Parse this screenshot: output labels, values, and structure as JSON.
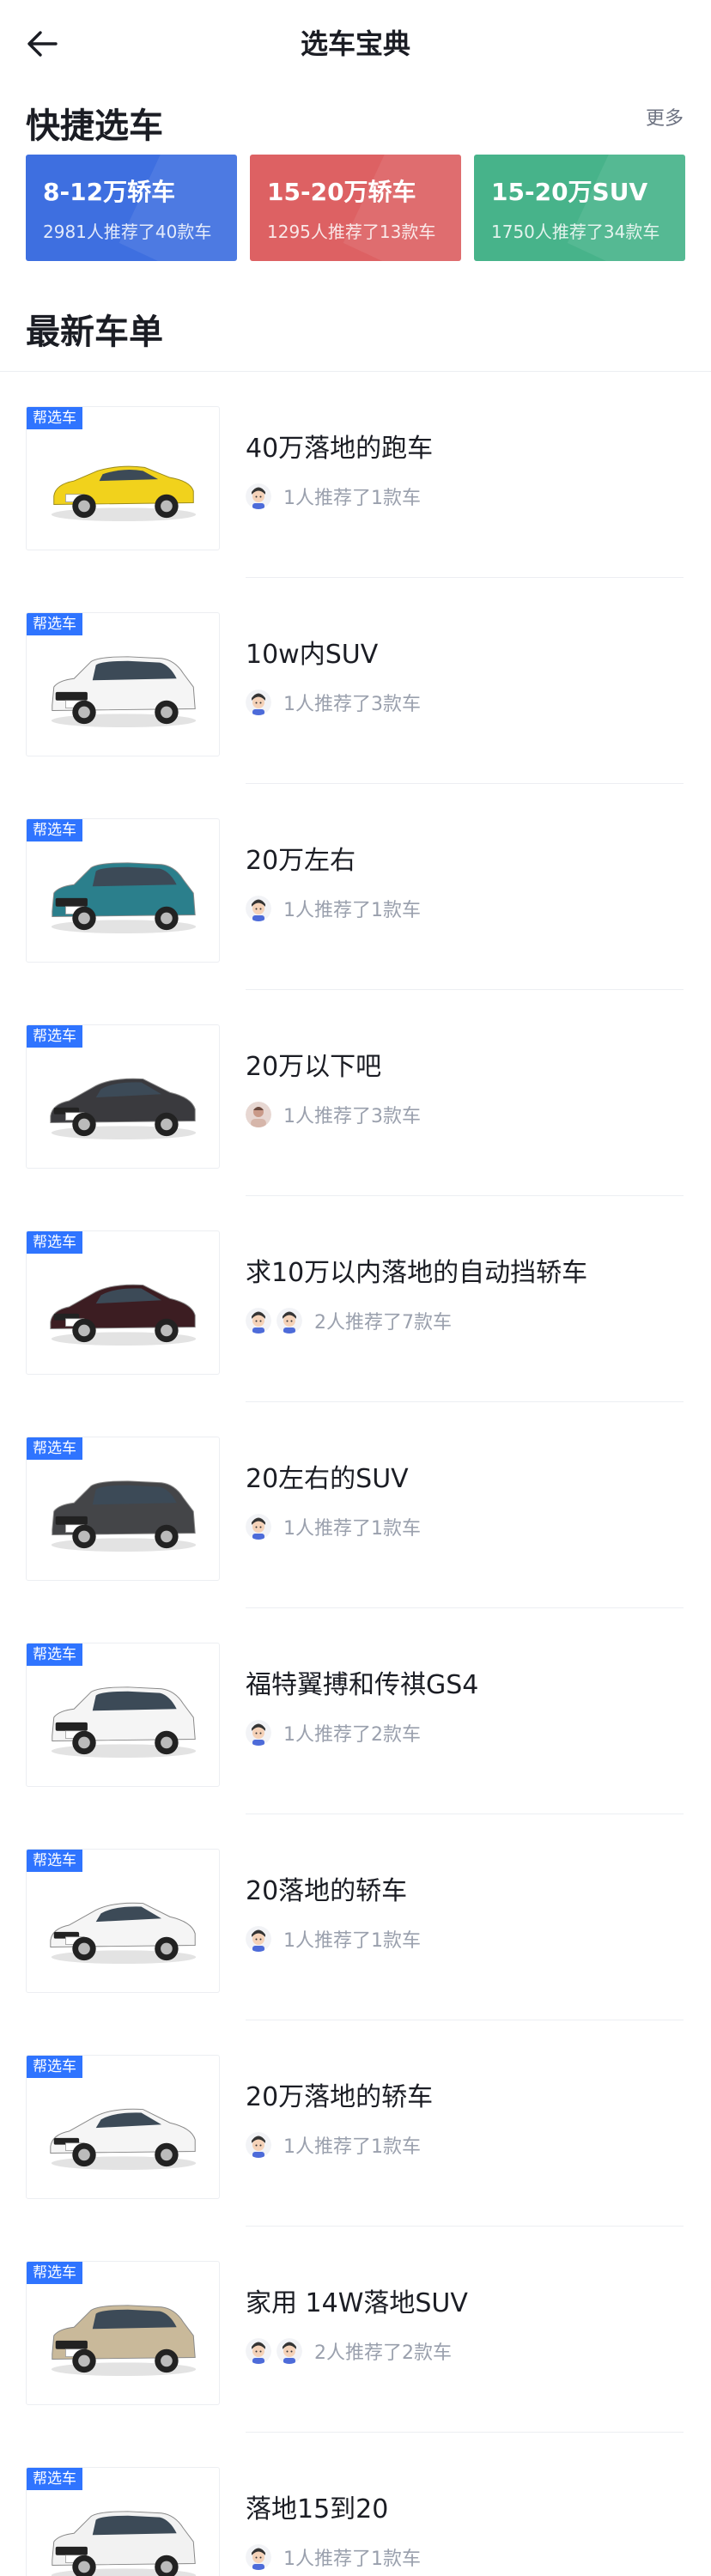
{
  "header": {
    "title": "选车宝典"
  },
  "quick": {
    "title": "快捷选车",
    "more": "更多",
    "cards": [
      {
        "title": "8-12万轿车",
        "sub": "2981人推荐了40款车",
        "color": "#3e6fe0"
      },
      {
        "title": "15-20万轿车",
        "sub": "1295人推荐了13款车",
        "color": "#dd6163"
      },
      {
        "title": "15-20万SUV",
        "sub": "1750人推荐了34款车",
        "color": "#47b38a"
      }
    ]
  },
  "latest": {
    "title": "最新车单",
    "tag": "帮选车",
    "items": [
      {
        "title": "40万落地的跑车",
        "meta": "1人推荐了1款车",
        "car": "sports",
        "color": "#f1d21c"
      },
      {
        "title": "10w内SUV",
        "meta": "1人推荐了3款车",
        "car": "suv",
        "color": "#f5f5f5"
      },
      {
        "title": "20万左右",
        "meta": "1人推荐了1款车",
        "car": "suv",
        "color": "#2b7f8c"
      },
      {
        "title": "20万以下吧",
        "meta": "1人推荐了3款车",
        "car": "sedan",
        "color": "#3a3a3e"
      },
      {
        "title": "求10万以内落地的自动挡轿车",
        "meta": "2人推荐了7款车",
        "car": "sedan",
        "color": "#3c1d22"
      },
      {
        "title": "20左右的SUV",
        "meta": "1人推荐了1款车",
        "car": "suv",
        "color": "#444548"
      },
      {
        "title": "福特翼搏和传祺GS4",
        "meta": "1人推荐了2款车",
        "car": "suv",
        "color": "#f5f5f5"
      },
      {
        "title": "20落地的轿车",
        "meta": "1人推荐了1款车",
        "car": "sedan",
        "color": "#f5f5f5"
      },
      {
        "title": "20万落地的轿车",
        "meta": "1人推荐了1款车",
        "car": "sedan",
        "color": "#f5f5f5"
      },
      {
        "title": "家用 14W落地SUV",
        "meta": "2人推荐了2款车",
        "car": "suv",
        "color": "#c9b99a"
      },
      {
        "title": "落地15到20",
        "meta": "1人推荐了1款车",
        "car": "suv",
        "color": "#f2f2f2"
      }
    ]
  },
  "colors": {
    "tag": "#2f74ff",
    "text": "#1b1d24",
    "muted": "#9aa0ad"
  }
}
